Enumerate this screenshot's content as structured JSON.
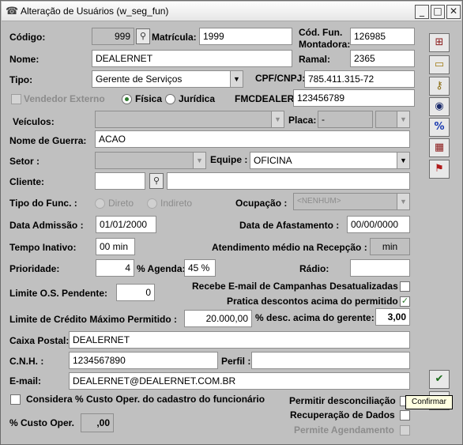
{
  "window": {
    "title": "Alteração de Usuários (w_seg_fun)",
    "minimize": "_",
    "maximize": "□",
    "close": "✕"
  },
  "labels": {
    "codigo": "Código:",
    "matricula": "Matrícula:",
    "cod_fun_1": "Cód. Fun.",
    "cod_fun_2": "Montadora:",
    "nome": "Nome:",
    "ramal": "Ramal:",
    "tipo": "Tipo:",
    "cpf": "CPF/CNPJ:",
    "vendedor_externo": "Vendedor Externo",
    "fisica": "Física",
    "juridica": "Jurídica",
    "fmcdealer": "FMCDEALER:",
    "veiculos": "Veículos:",
    "placa": "Placa:",
    "nome_guerra": "Nome de Guerra:",
    "setor": "Setor :",
    "equipe": "Equipe :",
    "cliente": "Cliente:",
    "tipo_func": "Tipo do Func. :",
    "direto": "Direto",
    "indireto": "Indireto",
    "ocupacao": "Ocupação :",
    "data_admissao": "Data Admissão :",
    "data_afastamento": "Data de Afastamento :",
    "tempo_inativo": "Tempo Inativo:",
    "atendimento": "Atendimento médio na Recepção :",
    "prioridade": "Prioridade:",
    "agenda": "% Agenda:",
    "radio": "Rádio:",
    "limite_os": "Limite O.S. Pendente:",
    "recebe_email": "Recebe E-mail de Campanhas Desatualizadas",
    "pratica_descontos": "Pratica descontos acima do permitido",
    "limite_credito": "Limite de Crédito Máximo Permitido :",
    "desc_gerente": "% desc. acima do gerente:",
    "caixa_postal": "Caixa Postal:",
    "cnh": "C.N.H. :",
    "perfil": "Perfil :",
    "email": "E-mail:",
    "considera_custo": "Considera % Custo Oper. do cadastro do funcionário",
    "permitir_desconc": "Permitir desconciliação",
    "recuperacao": "Recuperação de Dados",
    "permite_agendamento": "Permite Agendamento",
    "custo_oper": "% Custo Oper."
  },
  "values": {
    "codigo": "999",
    "matricula": "1999",
    "cod_fun": "126985",
    "nome": "DEALERNET",
    "ramal": "2365",
    "tipo": "Gerente de Serviços",
    "cpf": "785.411.315-72",
    "fmcdealer": "123456789",
    "veiculos": "",
    "placa": "-",
    "nome_guerra": "ACAO",
    "setor": "",
    "equipe": "OFICINA",
    "cliente_code": "",
    "cliente_name": "",
    "ocupacao": "<NENHUM>",
    "data_admissao": "01/01/2000",
    "data_afastamento": "00/00/0000",
    "tempo_inativo": "00 min",
    "atendimento": "min",
    "prioridade": "4",
    "agenda": "45 %",
    "radio": "",
    "limite_os": "0",
    "limite_credito": "20.000,00",
    "desc_gerente": "3,00",
    "caixa_postal": "DEALERNET",
    "cnh": "1234567890",
    "perfil": "",
    "email": "DEALERNET@DEALERNET.COM.BR",
    "custo_oper": ",00"
  },
  "states": {
    "vendedor_externo": false,
    "fisica": true,
    "juridica": false,
    "direto": false,
    "indireto": false,
    "recebe_email": false,
    "pratica_descontos": true,
    "considera_custo": false,
    "permitir_desconc": false,
    "recuperacao": false,
    "permite_agendamento": false
  },
  "tooltip": "Confirmar",
  "icons": {
    "checkmark": "✓",
    "arrow_down": "▼",
    "side_tools": [
      "network-icon",
      "folder-icon",
      "keys-icon",
      "camera-icon",
      "percent-icon",
      "cards-icon",
      "flags-icon",
      "confirm-icon",
      "cancel-icon"
    ]
  },
  "colors": {
    "window_bg": "#c0c0c0",
    "check_green": "#2d7a2d",
    "tooltip_bg": "#ffffe1"
  }
}
